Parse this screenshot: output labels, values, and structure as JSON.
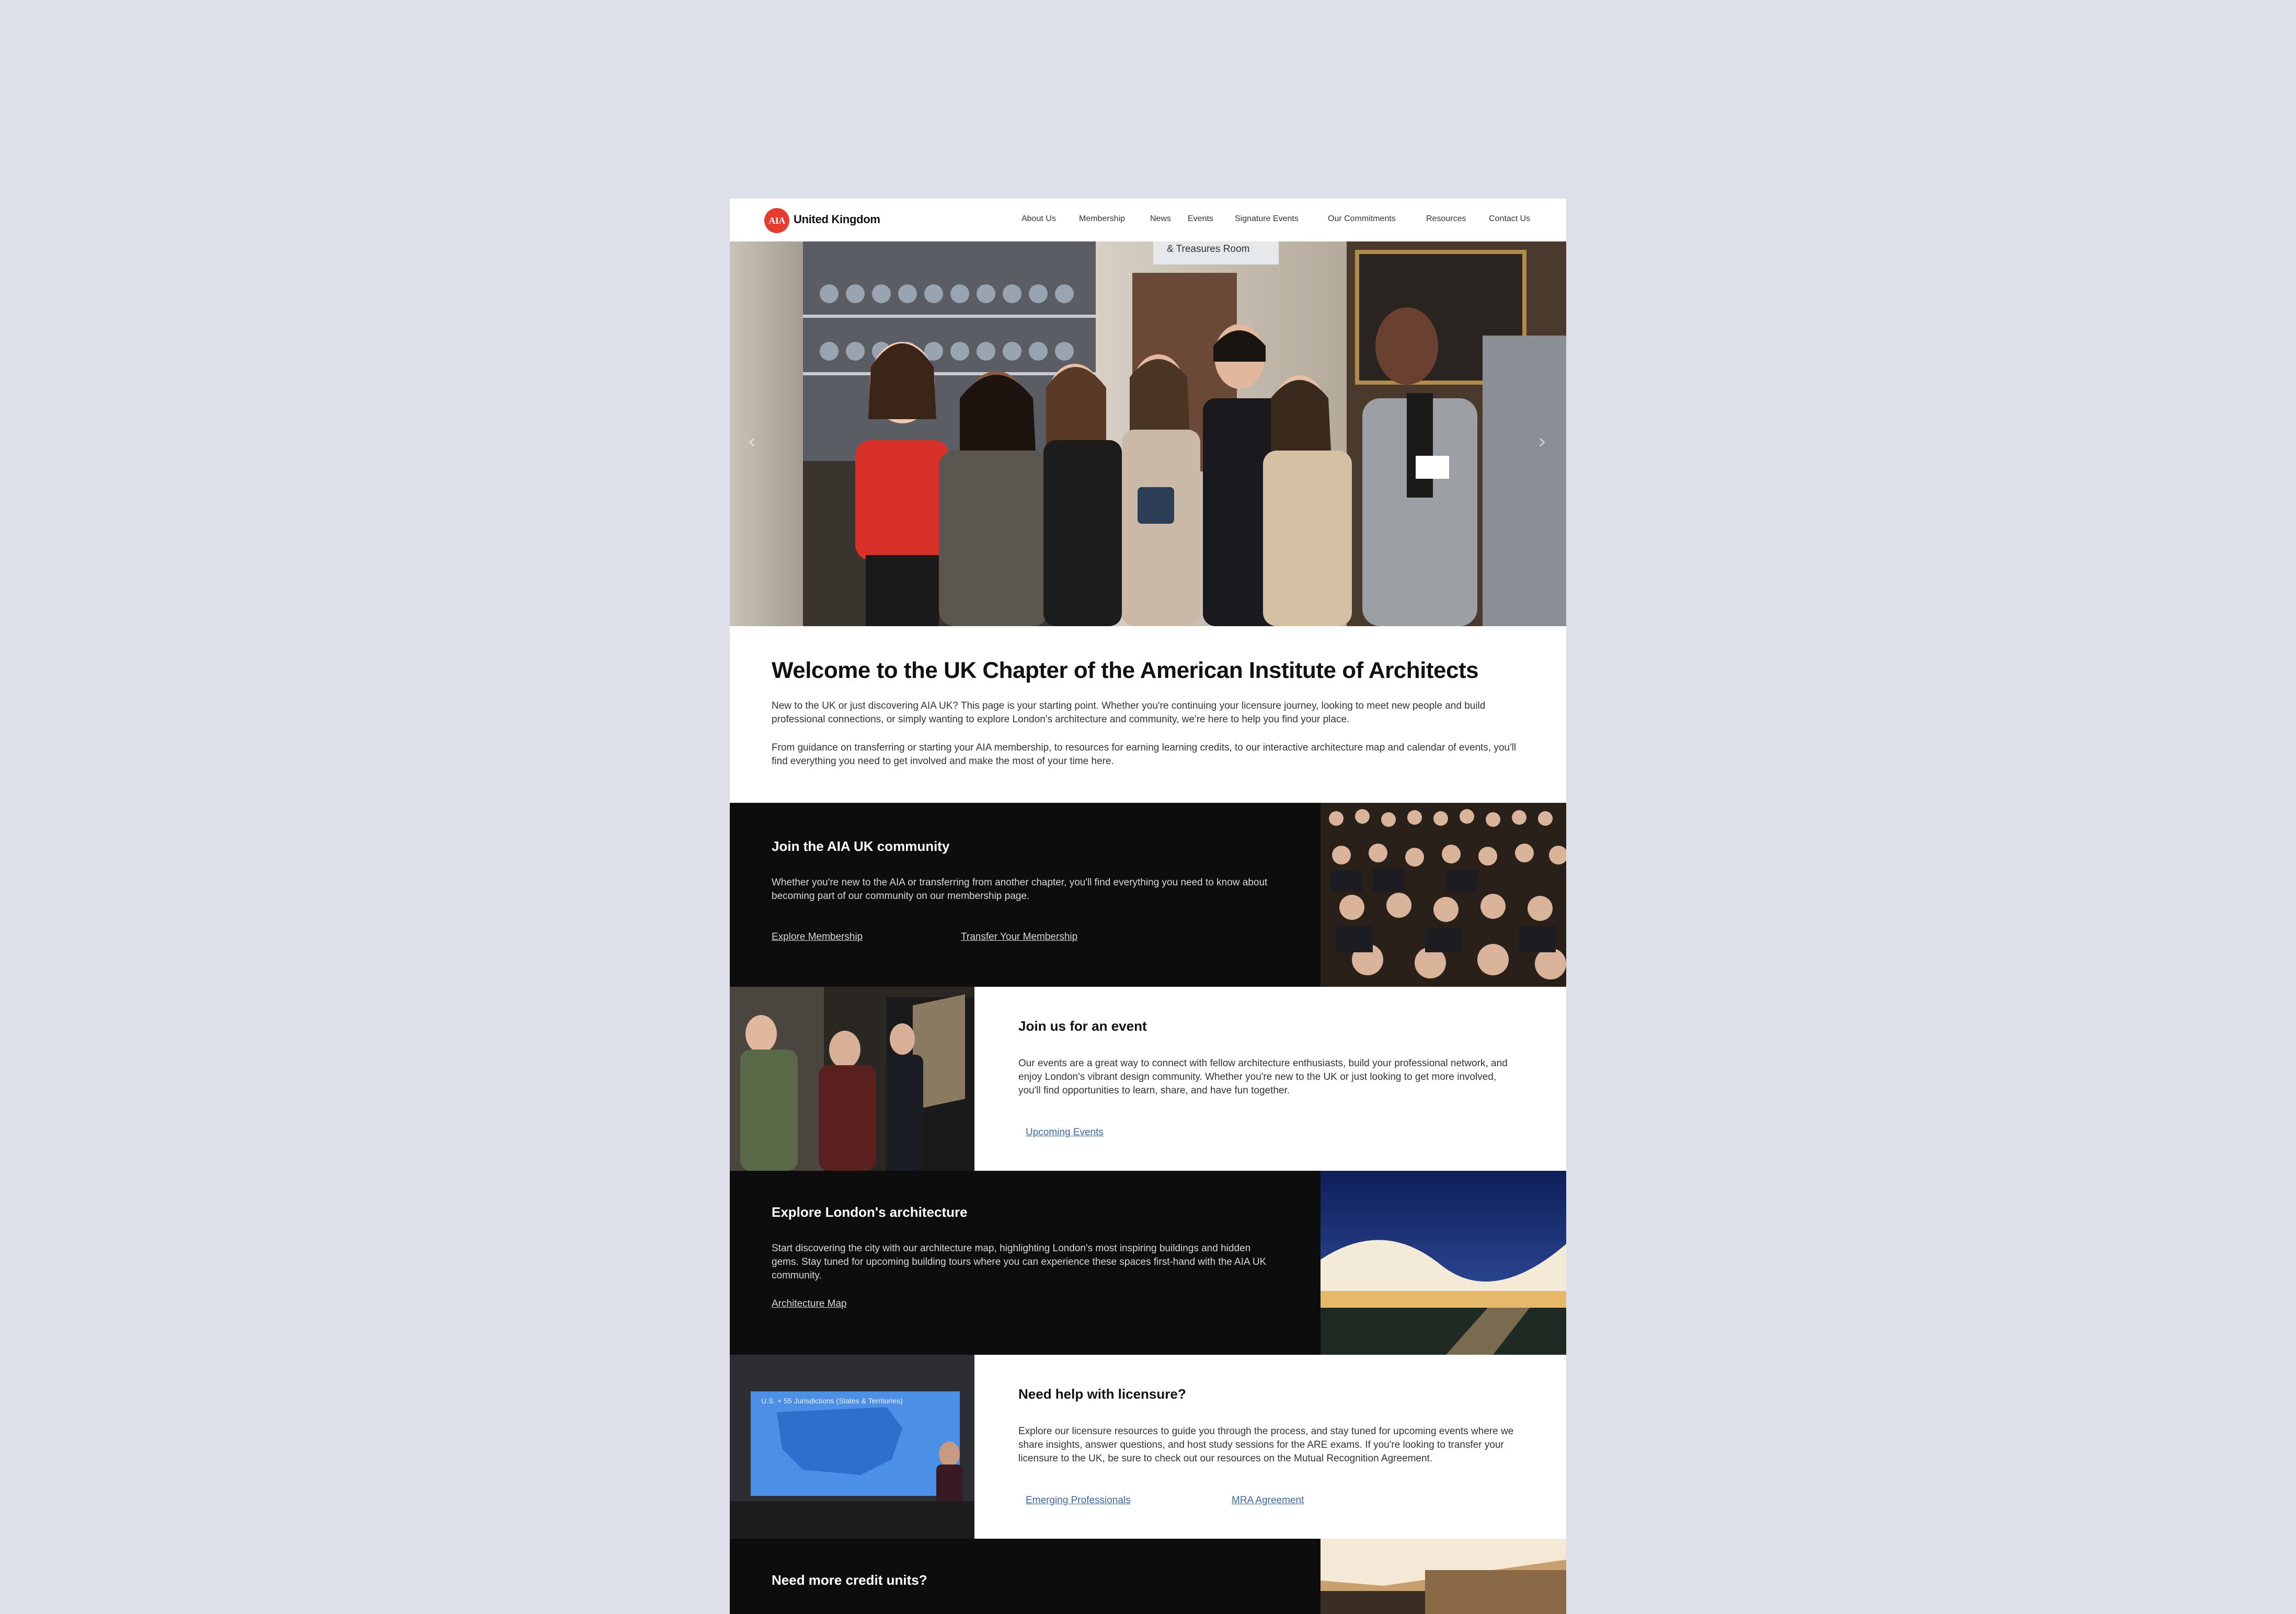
{
  "header": {
    "logo_mark": "AIA",
    "logo_text": "United Kingdom",
    "nav": [
      "About Us",
      "Membership",
      "News",
      "Events",
      "Signature Events",
      "Our Commitments",
      "Resources",
      "Contact Us"
    ]
  },
  "hero": {
    "sign_text": "& Treasures Room",
    "prev_arrow": "‹",
    "next_arrow": "›"
  },
  "intro": {
    "title": "Welcome to the UK Chapter of the American Institute of Architects",
    "paragraph_1": "New to the UK or just discovering AIA UK? This page is your starting point. Whether you're continuing your licensure journey, looking to meet new people and build professional connections, or simply wanting to explore London's architecture and community, we're here to help you find your place.",
    "paragraph_2": "From guidance on transferring or starting your AIA membership, to resources for earning learning credits, to our interactive architecture map and calendar of events, you'll find everything you need to get involved and make the most of your time here."
  },
  "sections": {
    "community": {
      "title": "Join the AIA UK community",
      "text": "Whether you're new to the AIA or transferring from another chapter, you'll find everything you need to know about becoming part of our community on our membership page.",
      "link_1": "Explore Membership",
      "link_2": "Transfer Your Membership"
    },
    "event": {
      "title": "Join us for an event",
      "text": "Our events are a great way to connect with fellow architecture enthusiasts, build your professional network, and enjoy London's vibrant design community. Whether you're new to the UK or just looking to get more involved, you'll find opportunities to learn, share, and have fun together.",
      "link_1": "Upcoming Events"
    },
    "architecture": {
      "title": "Explore London's architecture",
      "text": " Start discovering the city with our architecture map, highlighting London's most inspiring buildings and hidden gems. Stay tuned for upcoming building tours where you can experience these spaces first-hand with the AIA UK community.",
      "link_1": "Architecture Map"
    },
    "licensure": {
      "title": "Need help with licensure?",
      "text": "Explore our licensure resources to guide you through the process, and stay tuned for upcoming events where we share insights, answer questions, and host study sessions for the ARE exams. If you're looking to transfer your licensure to the UK, be sure to check out our resources on the Mutual Recognition Agreement.",
      "link_1": "Emerging Professionals",
      "link_2": "MRA Agreement",
      "slide_caption": "U.S. + 55 Jurisdictions (States & Territories)"
    },
    "credits": {
      "title": "Need more credit units?"
    }
  },
  "colors": {
    "brand_red": "#e63b2e",
    "dark_band": "#0d0d0d",
    "link_blue": "#3a68a3",
    "backdrop": "#dde0e8"
  }
}
